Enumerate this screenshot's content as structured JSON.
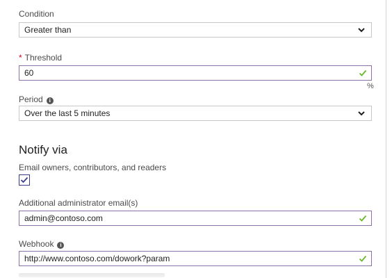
{
  "condition": {
    "label": "Condition",
    "value": "Greater than",
    "icon": "chevron-down-icon"
  },
  "threshold": {
    "required_mark": "*",
    "label": "Threshold",
    "value": "60",
    "unit": "%",
    "icon": "checkmark-icon"
  },
  "period": {
    "label": "Period",
    "info": "i",
    "value": "Over the last 5 minutes",
    "icon": "chevron-down-icon"
  },
  "notify": {
    "title": "Notify via",
    "email_owners_label": "Email owners, contributors, and readers",
    "email_owners_checked": true
  },
  "admin_email": {
    "label": "Additional administrator email(s)",
    "value": "admin@contoso.com",
    "icon": "checkmark-icon"
  },
  "webhook": {
    "label": "Webhook",
    "info": "i",
    "value": "http://www.contoso.com/dowork?param",
    "icon": "checkmark-icon"
  },
  "colors": {
    "valid_border": "#8a71a8",
    "check_green": "#6bb82b",
    "required": "#d0021b",
    "checkbox_accent": "#3a3a8c"
  }
}
